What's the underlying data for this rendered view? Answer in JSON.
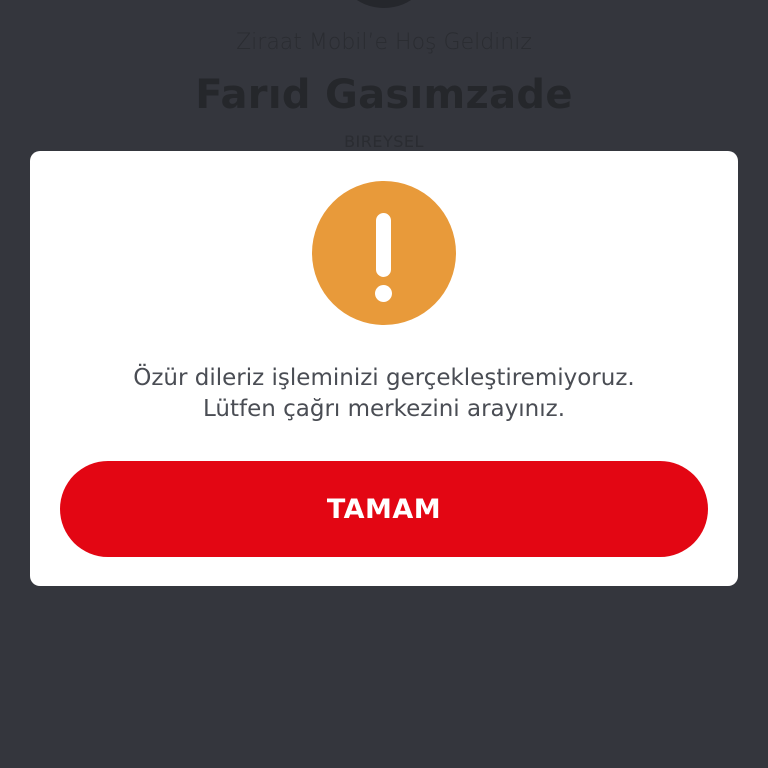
{
  "header": {
    "welcome_text": "Ziraat Mobil’e Hoş Geldiniz",
    "user_name": "Farıd Gasımzade",
    "segment": "BIREYSEL"
  },
  "dialog": {
    "icon": "warning-exclamation-icon",
    "message_line_1": "Özür dileriz işleminizi gerçekleştiremiyoruz.",
    "message_line_2": "Lütfen çağrı merkezini arayınız.",
    "ok_label": "TAMAM"
  },
  "colors": {
    "backdrop": "#34363d",
    "warning": "#e89a3a",
    "primary_button": "#e30613"
  }
}
